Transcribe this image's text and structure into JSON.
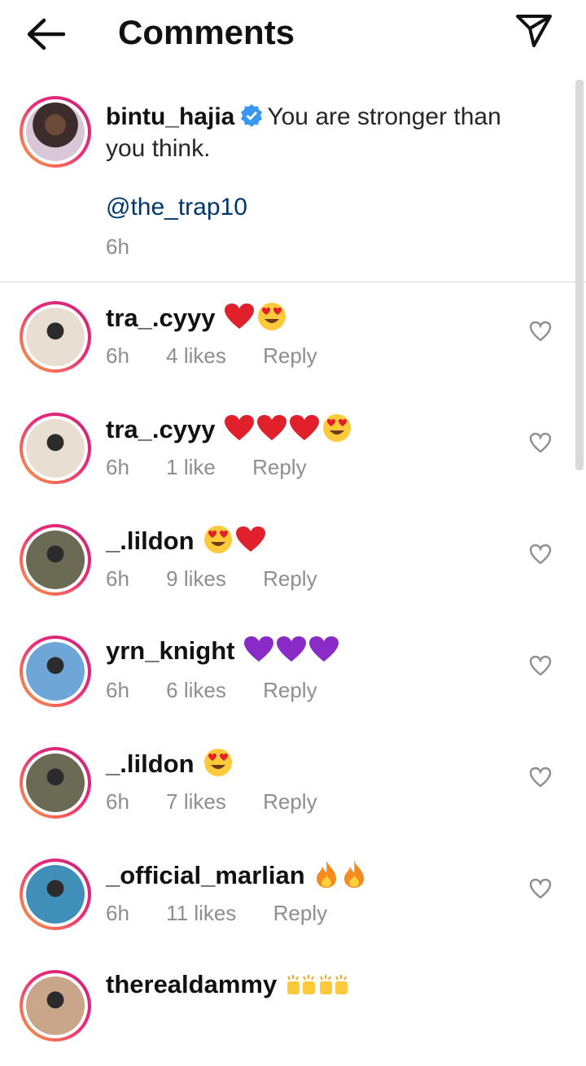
{
  "header": {
    "title": "Comments"
  },
  "caption": {
    "username": "bintu_hajia",
    "text": "You are stronger than you think.",
    "mention": "@the_trap10",
    "time": "6h"
  },
  "comments": [
    {
      "username": "tra_.cyyy",
      "emojis": [
        "red-heart",
        "heart-eyes"
      ],
      "time": "6h",
      "likes": "4 likes",
      "reply": "Reply",
      "avatar_color": "#e8dfd2"
    },
    {
      "username": "tra_.cyyy",
      "emojis": [
        "red-heart",
        "red-heart",
        "red-heart",
        "heart-eyes"
      ],
      "time": "6h",
      "likes": "1 like",
      "reply": "Reply",
      "avatar_color": "#e8dfd2"
    },
    {
      "username": "_.lildon",
      "emojis": [
        "heart-eyes",
        "red-heart"
      ],
      "time": "6h",
      "likes": "9 likes",
      "reply": "Reply",
      "avatar_color": "#6b6a55"
    },
    {
      "username": "yrn_knight",
      "emojis": [
        "purple-heart",
        "purple-heart",
        "purple-heart"
      ],
      "time": "6h",
      "likes": "6 likes",
      "reply": "Reply",
      "avatar_color": "#6fa6d8"
    },
    {
      "username": "_.lildon",
      "emojis": [
        "heart-eyes"
      ],
      "time": "6h",
      "likes": "7 likes",
      "reply": "Reply",
      "avatar_color": "#6b6a55"
    },
    {
      "username": "_official_marlian",
      "emojis": [
        "fire",
        "fire"
      ],
      "time": "6h",
      "likes": "11 likes",
      "reply": "Reply",
      "avatar_color": "#3f8fb8"
    },
    {
      "username": "therealdammy",
      "emojis": [
        "raising-hands",
        "raising-hands"
      ],
      "time": "",
      "likes": "",
      "reply": "",
      "avatar_color": "#c9a58a"
    }
  ]
}
